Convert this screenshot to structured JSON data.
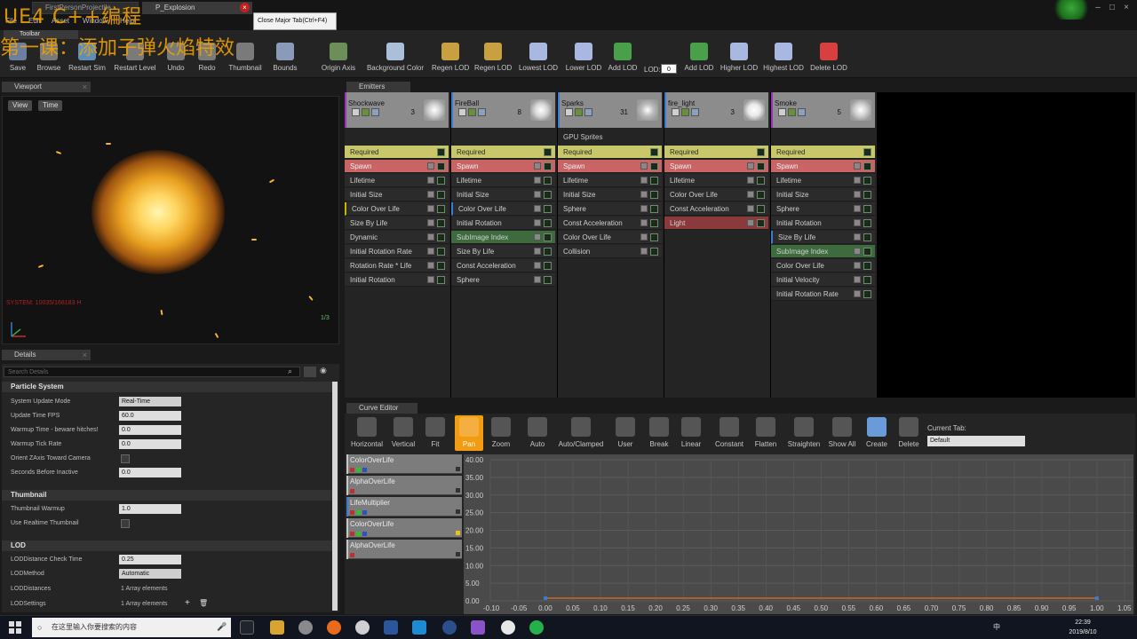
{
  "window": {
    "tabs": [
      {
        "label": "FirstPersonProjectile"
      },
      {
        "label": "P_Explosion"
      }
    ],
    "tooltip": "Close Major Tab(Ctrl+F4)",
    "menu": [
      "File",
      "Edit",
      "Asset",
      "Window",
      "Help"
    ]
  },
  "overlay": {
    "line1": "UE4 C++编程",
    "line2": "第一课：添加子弹火焰特效"
  },
  "toolbar": {
    "tab_label": "Toolbar",
    "lod_label": "LOD:",
    "lod_value": "0",
    "buttons": [
      {
        "label": "Save",
        "icon": "save-icon"
      },
      {
        "label": "Browse",
        "icon": "browse-icon"
      },
      {
        "label": "Restart Sim",
        "icon": "restart-sim-icon"
      },
      {
        "label": "Restart Level",
        "icon": "restart-level-icon"
      },
      {
        "label": "Undo",
        "icon": "undo-icon"
      },
      {
        "label": "Redo",
        "icon": "redo-icon"
      },
      {
        "label": "Thumbnail",
        "icon": "thumbnail-icon"
      },
      {
        "label": "Bounds",
        "icon": "bounds-icon"
      },
      {
        "label": "Origin Axis",
        "icon": "origin-axis-icon"
      },
      {
        "label": "Background Color",
        "icon": "background-color-icon"
      },
      {
        "label": "Regen LOD",
        "icon": "regen-lod-icon"
      },
      {
        "label": "Regen LOD",
        "icon": "regen-lod-icon"
      },
      {
        "label": "Lowest LOD",
        "icon": "lowest-lod-icon"
      },
      {
        "label": "Lower LOD",
        "icon": "lower-lod-icon"
      },
      {
        "label": "Add LOD",
        "icon": "add-lod-icon"
      },
      {
        "label": "Add LOD",
        "icon": "add-lod-icon"
      },
      {
        "label": "Higher LOD",
        "icon": "higher-lod-icon"
      },
      {
        "label": "Highest LOD",
        "icon": "highest-lod-icon"
      },
      {
        "label": "Delete LOD",
        "icon": "delete-lod-icon"
      }
    ]
  },
  "viewport": {
    "tab_label": "Viewport",
    "view_button": "View",
    "time_button": "Time",
    "status_red": "SYSTEM: 10035/168183 H",
    "status_green": "1/3"
  },
  "details": {
    "tab_label": "Details",
    "search_placeholder": "Search Details",
    "sections": {
      "particle_system": "Particle System",
      "thumbnail": "Thumbnail",
      "lod": "LOD"
    },
    "props": {
      "system_update_mode": {
        "label": "System Update Mode",
        "value": "Real-Time"
      },
      "update_time_fps": {
        "label": "Update Time FPS",
        "value": "60.0"
      },
      "warmup_time": {
        "label": "Warmup Time - beware hitches!",
        "value": "0.0"
      },
      "warmup_tick_rate": {
        "label": "Warmup Tick Rate",
        "value": "0.0"
      },
      "orient_zaxis": {
        "label": "Orient ZAxis Toward Camera"
      },
      "seconds_before_inactive": {
        "label": "Seconds Before Inactive",
        "value": "0.0"
      },
      "thumbnail_warmup": {
        "label": "Thumbnail Warmup",
        "value": "1.0"
      },
      "use_realtime_thumbnail": {
        "label": "Use Realtime Thumbnail"
      },
      "lod_distance_check_time": {
        "label": "LODDistance Check Time",
        "value": "0.25"
      },
      "lod_method": {
        "label": "LODMethod",
        "value": "Automatic"
      },
      "lod_distances": {
        "label": "LODDistances",
        "value": "1 Array elements"
      },
      "lod_settings": {
        "label": "LODSettings",
        "value": "1 Array elements"
      }
    }
  },
  "emitters": {
    "tab_label": "Emitters",
    "gpu_label": "GPU Sprites",
    "columns": [
      {
        "name": "Shockwave",
        "count": "3",
        "modules": [
          {
            "label": "Required"
          },
          {
            "label": "Spawn"
          },
          {
            "label": "Lifetime"
          },
          {
            "label": "Initial Size"
          },
          {
            "label": "Color Over Life"
          },
          {
            "label": "Size By Life"
          },
          {
            "label": "Dynamic"
          },
          {
            "label": "Initial Rotation Rate"
          },
          {
            "label": "Rotation Rate * Life"
          },
          {
            "label": "Initial Rotation"
          }
        ]
      },
      {
        "name": "FireBall",
        "count": "8",
        "modules": [
          {
            "label": "Required"
          },
          {
            "label": "Spawn"
          },
          {
            "label": "Lifetime"
          },
          {
            "label": "Initial Size"
          },
          {
            "label": "Color Over Life"
          },
          {
            "label": "Initial Rotation"
          },
          {
            "label": "SubImage Index"
          },
          {
            "label": "Size By Life"
          },
          {
            "label": "Const Acceleration"
          },
          {
            "label": "Sphere"
          }
        ]
      },
      {
        "name": "Sparks",
        "count": "31",
        "modules": [
          {
            "label": "Required"
          },
          {
            "label": "Spawn"
          },
          {
            "label": "Lifetime"
          },
          {
            "label": "Initial Size"
          },
          {
            "label": "Sphere"
          },
          {
            "label": "Const Acceleration"
          },
          {
            "label": "Color Over Life"
          },
          {
            "label": "Collision"
          }
        ]
      },
      {
        "name": "fire_light",
        "count": "3",
        "modules": [
          {
            "label": "Required"
          },
          {
            "label": "Spawn"
          },
          {
            "label": "Lifetime"
          },
          {
            "label": "Color Over Life"
          },
          {
            "label": "Const Acceleration"
          },
          {
            "label": "Light"
          }
        ]
      },
      {
        "name": "Smoke",
        "count": "5",
        "modules": [
          {
            "label": "Required"
          },
          {
            "label": "Spawn"
          },
          {
            "label": "Lifetime"
          },
          {
            "label": "Initial Size"
          },
          {
            "label": "Sphere"
          },
          {
            "label": "Initial Rotation"
          },
          {
            "label": "Size By Life"
          },
          {
            "label": "SubImage Index"
          },
          {
            "label": "Color Over Life"
          },
          {
            "label": "Initial Velocity"
          },
          {
            "label": "Initial Rotation Rate"
          }
        ]
      }
    ]
  },
  "curve_editor": {
    "tab_label": "Curve Editor",
    "current_tab_label": "Current Tab:",
    "current_tab_value": "Default",
    "buttons": [
      {
        "label": "Horizontal",
        "icon": "horizontal-icon"
      },
      {
        "label": "Vertical",
        "icon": "vertical-icon"
      },
      {
        "label": "Fit",
        "icon": "fit-icon"
      },
      {
        "label": "Pan",
        "icon": "pan-icon"
      },
      {
        "label": "Zoom",
        "icon": "zoom-icon"
      },
      {
        "label": "Auto",
        "icon": "auto-icon"
      },
      {
        "label": "Auto/Clamped",
        "icon": "auto-clamped-icon"
      },
      {
        "label": "User",
        "icon": "user-icon"
      },
      {
        "label": "Break",
        "icon": "break-icon"
      },
      {
        "label": "Linear",
        "icon": "linear-icon"
      },
      {
        "label": "Constant",
        "icon": "constant-icon"
      },
      {
        "label": "Flatten",
        "icon": "flatten-icon"
      },
      {
        "label": "Straighten",
        "icon": "straighten-icon"
      },
      {
        "label": "Show All",
        "icon": "show-all-icon"
      },
      {
        "label": "Create",
        "icon": "create-icon"
      },
      {
        "label": "Delete",
        "icon": "delete-icon"
      }
    ],
    "curves": [
      {
        "label": "ColorOverLife"
      },
      {
        "label": "AlphaOverLife"
      },
      {
        "label": "LifeMultiplier"
      },
      {
        "label": "ColorOverLife"
      },
      {
        "label": "AlphaOverLife"
      }
    ],
    "y_ticks": [
      "40.00",
      "35.00",
      "30.00",
      "25.00",
      "20.00",
      "15.00",
      "10.00",
      "5.00",
      "0.00"
    ],
    "x_ticks": [
      "-0.10",
      "-0.05",
      "0.00",
      "0.05",
      "0.10",
      "0.15",
      "0.20",
      "0.25",
      "0.30",
      "0.35",
      "0.40",
      "0.45",
      "0.50",
      "0.55",
      "0.60",
      "0.65",
      "0.70",
      "0.75",
      "0.80",
      "0.85",
      "0.90",
      "0.95",
      "1.00",
      "1.05"
    ]
  },
  "taskbar": {
    "search_placeholder": "在这里输入你要搜索的内容",
    "time": "22:39",
    "date": "2019/8/10",
    "tray_text": "中"
  }
}
